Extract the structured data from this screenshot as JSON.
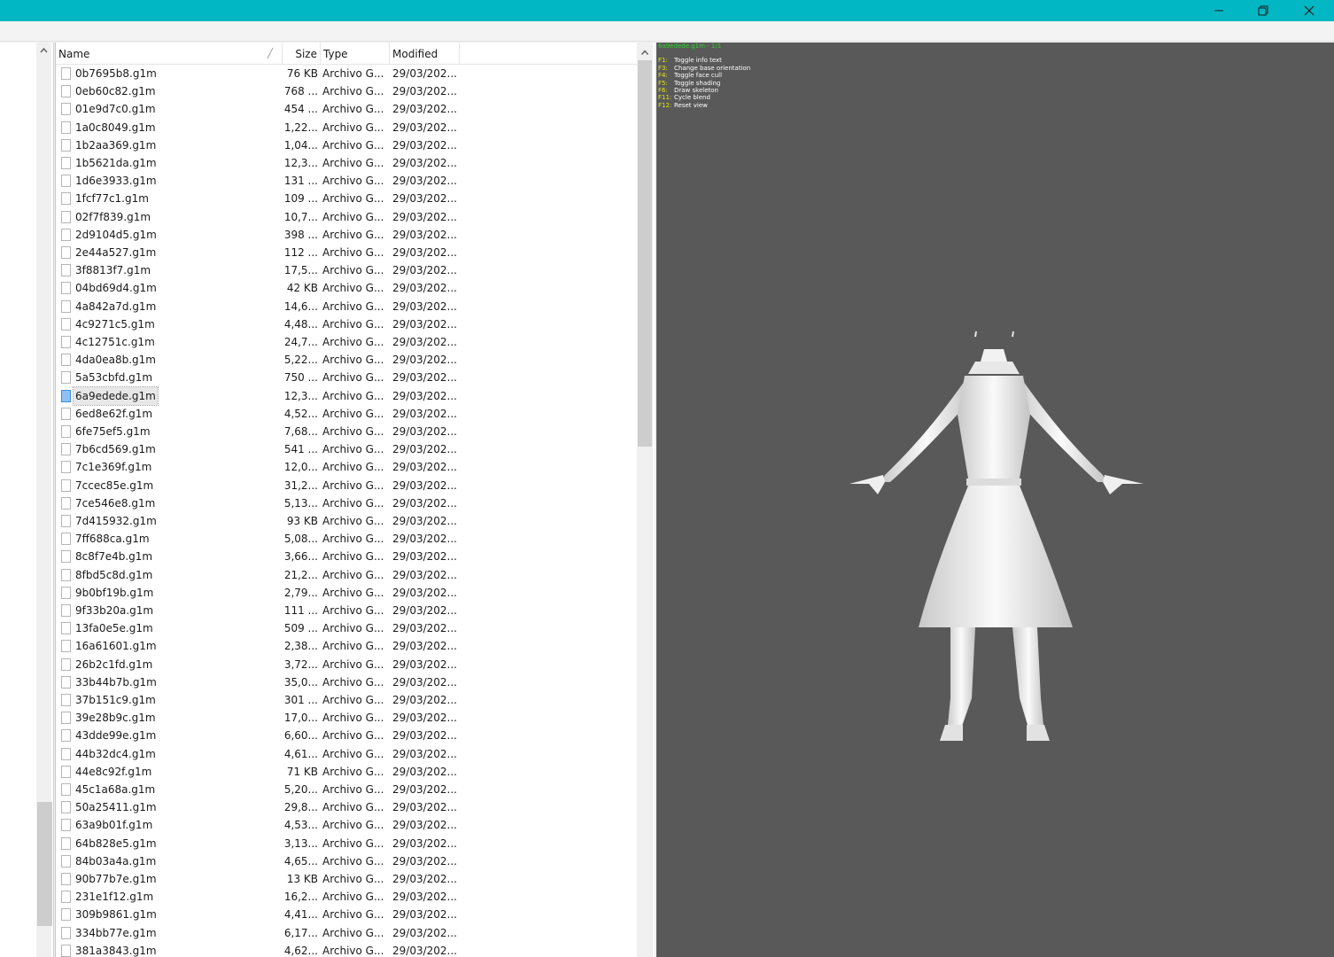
{
  "window": {
    "minimize_icon": "minimize-icon",
    "restore_icon": "restore-icon",
    "close_icon": "close-icon",
    "titlebar_color": "#00b7c3"
  },
  "file_list": {
    "columns": {
      "name": "Name",
      "size": "Size",
      "type": "Type",
      "modified": "Modified"
    },
    "selected_file": "6a9edede.g1m",
    "rows": [
      {
        "name": "0b7695b8.g1m",
        "size": "76 KB",
        "type": "Archivo G...",
        "modified": "29/03/202..."
      },
      {
        "name": "0eb60c82.g1m",
        "size": "768 ...",
        "type": "Archivo G...",
        "modified": "29/03/202..."
      },
      {
        "name": "01e9d7c0.g1m",
        "size": "454 ...",
        "type": "Archivo G...",
        "modified": "29/03/202..."
      },
      {
        "name": "1a0c8049.g1m",
        "size": "1,22...",
        "type": "Archivo G...",
        "modified": "29/03/202..."
      },
      {
        "name": "1b2aa369.g1m",
        "size": "1,04...",
        "type": "Archivo G...",
        "modified": "29/03/202..."
      },
      {
        "name": "1b5621da.g1m",
        "size": "12,3...",
        "type": "Archivo G...",
        "modified": "29/03/202..."
      },
      {
        "name": "1d6e3933.g1m",
        "size": "131 ...",
        "type": "Archivo G...",
        "modified": "29/03/202..."
      },
      {
        "name": "1fcf77c1.g1m",
        "size": "109 ...",
        "type": "Archivo G...",
        "modified": "29/03/202..."
      },
      {
        "name": "02f7f839.g1m",
        "size": "10,7...",
        "type": "Archivo G...",
        "modified": "29/03/202..."
      },
      {
        "name": "2d9104d5.g1m",
        "size": "398 ...",
        "type": "Archivo G...",
        "modified": "29/03/202..."
      },
      {
        "name": "2e44a527.g1m",
        "size": "112 ...",
        "type": "Archivo G...",
        "modified": "29/03/202..."
      },
      {
        "name": "3f8813f7.g1m",
        "size": "17,5...",
        "type": "Archivo G...",
        "modified": "29/03/202..."
      },
      {
        "name": "04bd69d4.g1m",
        "size": "42 KB",
        "type": "Archivo G...",
        "modified": "29/03/202..."
      },
      {
        "name": "4a842a7d.g1m",
        "size": "14,6...",
        "type": "Archivo G...",
        "modified": "29/03/202..."
      },
      {
        "name": "4c9271c5.g1m",
        "size": "4,48...",
        "type": "Archivo G...",
        "modified": "29/03/202..."
      },
      {
        "name": "4c12751c.g1m",
        "size": "24,7...",
        "type": "Archivo G...",
        "modified": "29/03/202..."
      },
      {
        "name": "4da0ea8b.g1m",
        "size": "5,22...",
        "type": "Archivo G...",
        "modified": "29/03/202..."
      },
      {
        "name": "5a53cbfd.g1m",
        "size": "750 ...",
        "type": "Archivo G...",
        "modified": "29/03/202..."
      },
      {
        "name": "6a9edede.g1m",
        "size": "12,3...",
        "type": "Archivo G...",
        "modified": "29/03/202...",
        "selected": true
      },
      {
        "name": "6ed8e62f.g1m",
        "size": "4,52...",
        "type": "Archivo G...",
        "modified": "29/03/202..."
      },
      {
        "name": "6fe75ef5.g1m",
        "size": "7,68...",
        "type": "Archivo G...",
        "modified": "29/03/202..."
      },
      {
        "name": "7b6cd569.g1m",
        "size": "541 ...",
        "type": "Archivo G...",
        "modified": "29/03/202..."
      },
      {
        "name": "7c1e369f.g1m",
        "size": "12,0...",
        "type": "Archivo G...",
        "modified": "29/03/202..."
      },
      {
        "name": "7ccec85e.g1m",
        "size": "31,2...",
        "type": "Archivo G...",
        "modified": "29/03/202..."
      },
      {
        "name": "7ce546e8.g1m",
        "size": "5,13...",
        "type": "Archivo G...",
        "modified": "29/03/202..."
      },
      {
        "name": "7d415932.g1m",
        "size": "93 KB",
        "type": "Archivo G...",
        "modified": "29/03/202..."
      },
      {
        "name": "7ff688ca.g1m",
        "size": "5,08...",
        "type": "Archivo G...",
        "modified": "29/03/202..."
      },
      {
        "name": "8c8f7e4b.g1m",
        "size": "3,66...",
        "type": "Archivo G...",
        "modified": "29/03/202..."
      },
      {
        "name": "8fbd5c8d.g1m",
        "size": "21,2...",
        "type": "Archivo G...",
        "modified": "29/03/202..."
      },
      {
        "name": "9b0bf19b.g1m",
        "size": "2,79...",
        "type": "Archivo G...",
        "modified": "29/03/202..."
      },
      {
        "name": "9f33b20a.g1m",
        "size": "111 ...",
        "type": "Archivo G...",
        "modified": "29/03/202..."
      },
      {
        "name": "13fa0e5e.g1m",
        "size": "509 ...",
        "type": "Archivo G...",
        "modified": "29/03/202..."
      },
      {
        "name": "16a61601.g1m",
        "size": "2,38...",
        "type": "Archivo G...",
        "modified": "29/03/202..."
      },
      {
        "name": "26b2c1fd.g1m",
        "size": "3,72...",
        "type": "Archivo G...",
        "modified": "29/03/202..."
      },
      {
        "name": "33b44b7b.g1m",
        "size": "35,0...",
        "type": "Archivo G...",
        "modified": "29/03/202..."
      },
      {
        "name": "37b151c9.g1m",
        "size": "301 ...",
        "type": "Archivo G...",
        "modified": "29/03/202..."
      },
      {
        "name": "39e28b9c.g1m",
        "size": "17,0...",
        "type": "Archivo G...",
        "modified": "29/03/202..."
      },
      {
        "name": "43dde99e.g1m",
        "size": "6,60...",
        "type": "Archivo G...",
        "modified": "29/03/202..."
      },
      {
        "name": "44b32dc4.g1m",
        "size": "4,61...",
        "type": "Archivo G...",
        "modified": "29/03/202..."
      },
      {
        "name": "44e8c92f.g1m",
        "size": "71 KB",
        "type": "Archivo G...",
        "modified": "29/03/202..."
      },
      {
        "name": "45c1a68a.g1m",
        "size": "5,20...",
        "type": "Archivo G...",
        "modified": "29/03/202..."
      },
      {
        "name": "50a25411.g1m",
        "size": "29,8...",
        "type": "Archivo G...",
        "modified": "29/03/202..."
      },
      {
        "name": "63a9b01f.g1m",
        "size": "4,53...",
        "type": "Archivo G...",
        "modified": "29/03/202..."
      },
      {
        "name": "64b828e5.g1m",
        "size": "3,13...",
        "type": "Archivo G...",
        "modified": "29/03/202..."
      },
      {
        "name": "84b03a4a.g1m",
        "size": "4,65...",
        "type": "Archivo G...",
        "modified": "29/03/202..."
      },
      {
        "name": "90b77b7e.g1m",
        "size": "13 KB",
        "type": "Archivo G...",
        "modified": "29/03/202..."
      },
      {
        "name": "231e1f12.g1m",
        "size": "16,2...",
        "type": "Archivo G...",
        "modified": "29/03/202..."
      },
      {
        "name": "309b9861.g1m",
        "size": "4,41...",
        "type": "Archivo G...",
        "modified": "29/03/202..."
      },
      {
        "name": "334bb77e.g1m",
        "size": "6,17...",
        "type": "Archivo G...",
        "modified": "29/03/202..."
      },
      {
        "name": "381a3843.g1m",
        "size": "4,62...",
        "type": "Archivo G...",
        "modified": "29/03/202..."
      }
    ]
  },
  "viewer": {
    "background": "#595959",
    "file_title": "6a9edede.g1m - 1/1",
    "shortcuts": [
      {
        "key": "F1:",
        "desc": "Toggle info text"
      },
      {
        "key": "F3:",
        "desc": "Change base orientation"
      },
      {
        "key": "F4:",
        "desc": "Toggle face cull"
      },
      {
        "key": "F5:",
        "desc": "Toggle shading"
      },
      {
        "key": "F6:",
        "desc": "Draw skeleton"
      },
      {
        "key": "F11:",
        "desc": "Cycle blend"
      },
      {
        "key": "F12:",
        "desc": "Reset view"
      }
    ]
  }
}
